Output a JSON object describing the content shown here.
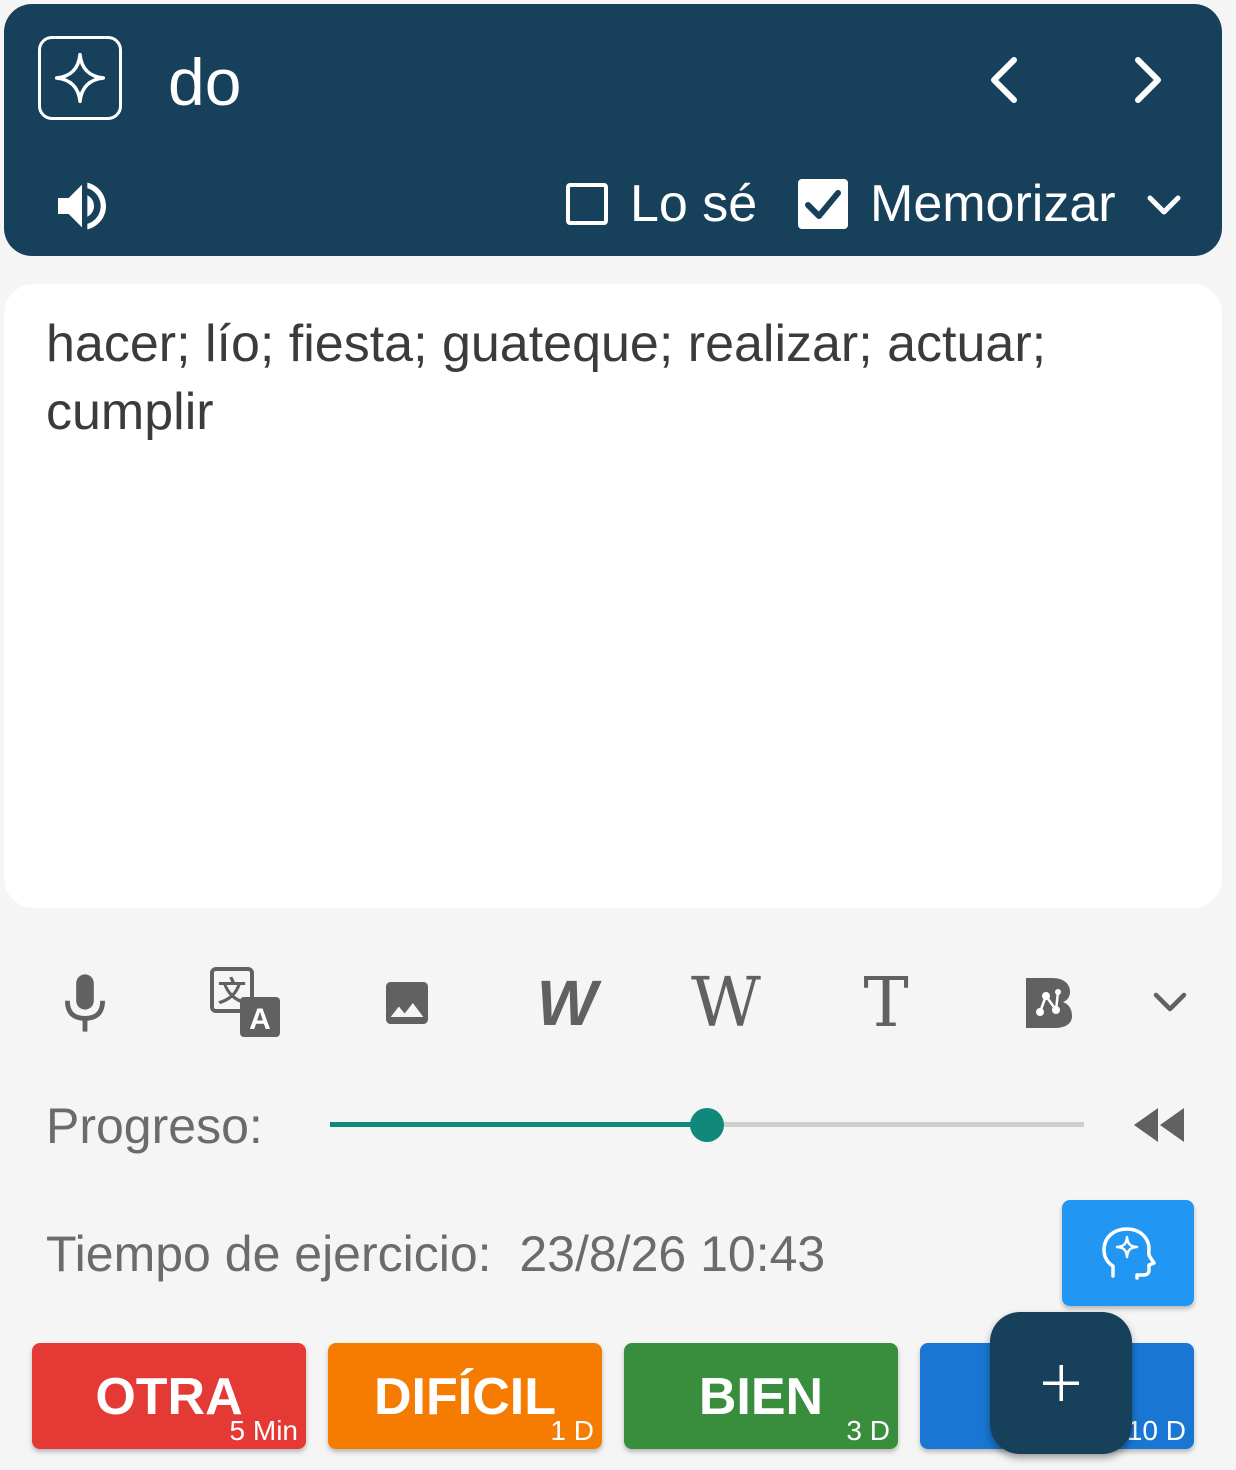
{
  "header": {
    "word": "do",
    "know_label": "Lo sé",
    "know_checked": false,
    "memorize_label": "Memorizar",
    "memorize_checked": true
  },
  "card": {
    "meaning": "hacer; lío; fiesta; guateque; realizar; actuar; cumplir"
  },
  "toolbar": {
    "icons": [
      "mic-icon",
      "translate-icon",
      "image-icon",
      "w-bold-italic-icon",
      "wikipedia-icon",
      "text-t-icon",
      "b-network-icon",
      "chevron-down-icon"
    ],
    "wikipedia_glyph": "W",
    "text_glyph": "T"
  },
  "progress": {
    "label": "Progreso:",
    "fraction": 0.5,
    "color": "#11897a"
  },
  "exercise": {
    "label": "Tiempo de ejercicio:",
    "value": "23/8/26 10:43"
  },
  "answers": [
    {
      "label": "OTRA",
      "interval": "5 Min",
      "color": "#e53935"
    },
    {
      "label": "DIFÍCIL",
      "interval": "1 D",
      "color": "#f57c00"
    },
    {
      "label": "BIEN",
      "interval": "3 D",
      "color": "#388e3c"
    },
    {
      "label": "",
      "interval": "10 D",
      "color": "#1976d2"
    }
  ],
  "colors": {
    "header_bg": "#17405a",
    "brain_button": "#2196f3"
  }
}
